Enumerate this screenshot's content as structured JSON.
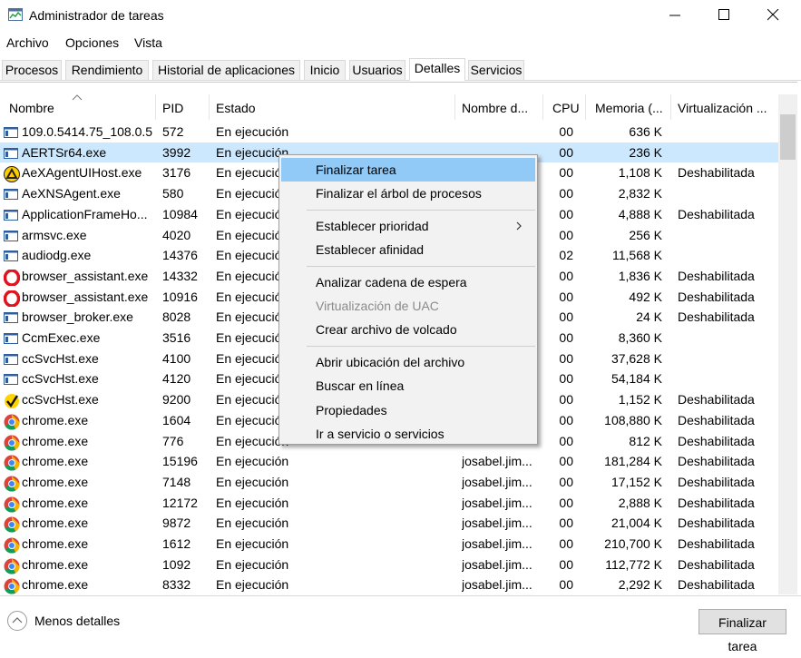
{
  "window": {
    "title": "Administrador de tareas",
    "controls": [
      "minimize",
      "maximize",
      "close"
    ]
  },
  "menu": [
    "Archivo",
    "Opciones",
    "Vista"
  ],
  "tabs": [
    {
      "label": "Procesos",
      "active": false
    },
    {
      "label": "Rendimiento",
      "active": false
    },
    {
      "label": "Historial de aplicaciones",
      "active": false
    },
    {
      "label": "Inicio",
      "active": false
    },
    {
      "label": "Usuarios",
      "active": false
    },
    {
      "label": "Detalles",
      "active": true
    },
    {
      "label": "Servicios",
      "active": false
    }
  ],
  "table": {
    "columns": [
      "Nombre",
      "PID",
      "Estado",
      "Nombre d...",
      "CPU",
      "Memoria (...",
      "Virtualización ..."
    ],
    "rows": [
      {
        "name": "109.0.5414.75_108.0.5...",
        "pid": "572",
        "status": "En ejecución",
        "user": "",
        "cpu": "00",
        "mem": "636 K",
        "virt": "",
        "icon": "window-icon"
      },
      {
        "name": "AERTSr64.exe",
        "pid": "3992",
        "status": "En ejecución",
        "user": "",
        "cpu": "00",
        "mem": "236 K",
        "virt": "",
        "icon": "window-icon",
        "selected": true
      },
      {
        "name": "AeXAgentUIHost.exe",
        "pid": "3176",
        "status": "En ejecución",
        "user": "",
        "cpu": "00",
        "mem": "1,108 K",
        "virt": "Deshabilitada",
        "icon": "altiris-agent-icon"
      },
      {
        "name": "AeXNSAgent.exe",
        "pid": "580",
        "status": "En ejecución",
        "user": "",
        "cpu": "00",
        "mem": "2,832 K",
        "virt": "",
        "icon": "window-icon"
      },
      {
        "name": "ApplicationFrameHo...",
        "pid": "10984",
        "status": "En ejecución",
        "user": "",
        "cpu": "00",
        "mem": "4,888 K",
        "virt": "Deshabilitada",
        "icon": "window-icon"
      },
      {
        "name": "armsvc.exe",
        "pid": "4020",
        "status": "En ejecución",
        "user": "",
        "cpu": "00",
        "mem": "256 K",
        "virt": "",
        "icon": "window-icon"
      },
      {
        "name": "audiodg.exe",
        "pid": "14376",
        "status": "En ejecución",
        "user": "",
        "cpu": "02",
        "mem": "11,568 K",
        "virt": "",
        "icon": "window-icon"
      },
      {
        "name": "browser_assistant.exe",
        "pid": "14332",
        "status": "En ejecución",
        "user": "",
        "cpu": "00",
        "mem": "1,836 K",
        "virt": "Deshabilitada",
        "icon": "opera-icon"
      },
      {
        "name": "browser_assistant.exe",
        "pid": "10916",
        "status": "En ejecución",
        "user": "",
        "cpu": "00",
        "mem": "492 K",
        "virt": "Deshabilitada",
        "icon": "opera-icon"
      },
      {
        "name": "browser_broker.exe",
        "pid": "8028",
        "status": "En ejecución",
        "user": "",
        "cpu": "00",
        "mem": "24 K",
        "virt": "Deshabilitada",
        "icon": "window-icon"
      },
      {
        "name": "CcmExec.exe",
        "pid": "3516",
        "status": "En ejecución",
        "user": "",
        "cpu": "00",
        "mem": "8,360 K",
        "virt": "",
        "icon": "window-icon"
      },
      {
        "name": "ccSvcHst.exe",
        "pid": "4100",
        "status": "En ejecución",
        "user": "",
        "cpu": "00",
        "mem": "37,628 K",
        "virt": "",
        "icon": "window-icon"
      },
      {
        "name": "ccSvcHst.exe",
        "pid": "4120",
        "status": "En ejecución",
        "user": "",
        "cpu": "00",
        "mem": "54,184 K",
        "virt": "",
        "icon": "window-icon"
      },
      {
        "name": "ccSvcHst.exe",
        "pid": "9200",
        "status": "En ejecución",
        "user": "",
        "cpu": "00",
        "mem": "1,152 K",
        "virt": "Deshabilitada",
        "icon": "norton-check-icon"
      },
      {
        "name": "chrome.exe",
        "pid": "1604",
        "status": "En ejecución",
        "user": "",
        "cpu": "00",
        "mem": "108,880 K",
        "virt": "Deshabilitada",
        "icon": "chrome-icon"
      },
      {
        "name": "chrome.exe",
        "pid": "776",
        "status": "En ejecución",
        "user": "",
        "cpu": "00",
        "mem": "812 K",
        "virt": "Deshabilitada",
        "icon": "chrome-icon"
      },
      {
        "name": "chrome.exe",
        "pid": "15196",
        "status": "En ejecución",
        "user": "josabel.jim...",
        "cpu": "00",
        "mem": "181,284 K",
        "virt": "Deshabilitada",
        "icon": "chrome-icon"
      },
      {
        "name": "chrome.exe",
        "pid": "7148",
        "status": "En ejecución",
        "user": "josabel.jim...",
        "cpu": "00",
        "mem": "17,152 K",
        "virt": "Deshabilitada",
        "icon": "chrome-icon"
      },
      {
        "name": "chrome.exe",
        "pid": "12172",
        "status": "En ejecución",
        "user": "josabel.jim...",
        "cpu": "00",
        "mem": "2,888 K",
        "virt": "Deshabilitada",
        "icon": "chrome-icon"
      },
      {
        "name": "chrome.exe",
        "pid": "9872",
        "status": "En ejecución",
        "user": "josabel.jim...",
        "cpu": "00",
        "mem": "21,004 K",
        "virt": "Deshabilitada",
        "icon": "chrome-icon"
      },
      {
        "name": "chrome.exe",
        "pid": "1612",
        "status": "En ejecución",
        "user": "josabel.jim...",
        "cpu": "00",
        "mem": "210,700 K",
        "virt": "Deshabilitada",
        "icon": "chrome-icon"
      },
      {
        "name": "chrome.exe",
        "pid": "1092",
        "status": "En ejecución",
        "user": "josabel.jim...",
        "cpu": "00",
        "mem": "112,772 K",
        "virt": "Deshabilitada",
        "icon": "chrome-icon"
      },
      {
        "name": "chrome.exe",
        "pid": "8332",
        "status": "En ejecución",
        "user": "josabel.jim...",
        "cpu": "00",
        "mem": "2,292 K",
        "virt": "Deshabilitada",
        "icon": "chrome-icon"
      }
    ]
  },
  "context_menu": {
    "items": [
      {
        "label": "Finalizar tarea",
        "highlighted": true
      },
      {
        "label": "Finalizar el árbol de procesos"
      },
      {
        "separator": true
      },
      {
        "label": "Establecer prioridad",
        "submenu": true
      },
      {
        "label": "Establecer afinidad"
      },
      {
        "separator": true
      },
      {
        "label": "Analizar cadena de espera"
      },
      {
        "label": "Virtualización de UAC",
        "disabled": true
      },
      {
        "label": "Crear archivo de volcado"
      },
      {
        "separator": true
      },
      {
        "label": "Abrir ubicación del archivo"
      },
      {
        "label": "Buscar en línea"
      },
      {
        "label": "Propiedades"
      },
      {
        "label": "Ir a servicio o servicios"
      }
    ]
  },
  "footer": {
    "less_details": "Menos detalles",
    "end_task": "Finalizar tarea"
  },
  "colors": {
    "selection": "#cce8ff",
    "menu_highlight": "#91c9f7",
    "menu_bg": "#f2f2f2"
  }
}
